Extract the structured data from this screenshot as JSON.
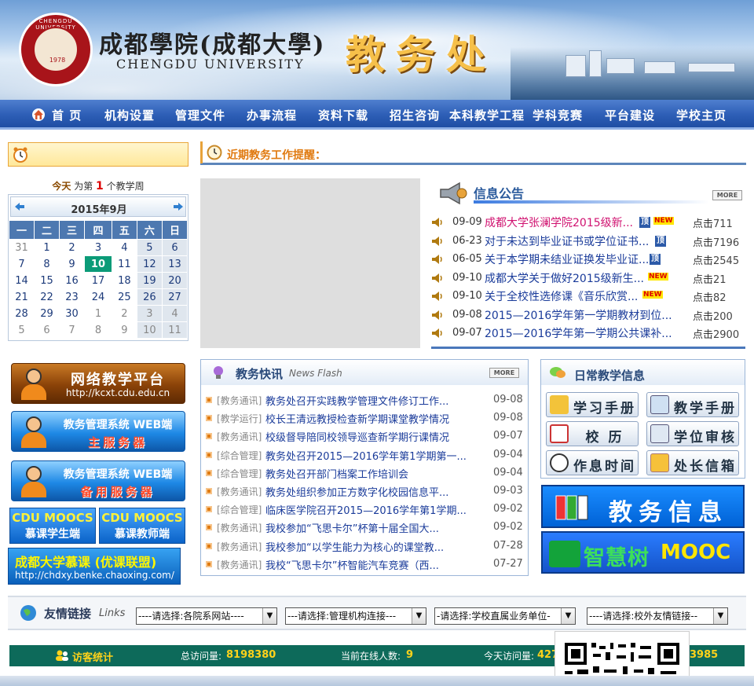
{
  "banner": {
    "school_cn": "成都學院(成都大學)",
    "school_en": "CHENGDU UNIVERSITY",
    "seal_ring": "CHENGDU UNIVERSITY",
    "seal_year": "1978",
    "office": "教务处"
  },
  "nav": {
    "items": [
      "首 页",
      "机构设置",
      "管理文件",
      "办事流程",
      "资料下载",
      "招生咨询",
      "本科教学工程",
      "学科竞赛",
      "平台建设",
      "学校主页"
    ]
  },
  "week": {
    "prefix": "今天",
    "mid": "为第",
    "num": "1",
    "suffix": "个教学周"
  },
  "calendar": {
    "title": "2015年9月",
    "weekdays": [
      "一",
      "二",
      "三",
      "四",
      "五",
      "六",
      "日"
    ],
    "rows": [
      [
        "31",
        "1",
        "2",
        "3",
        "4",
        "5",
        "6"
      ],
      [
        "7",
        "8",
        "9",
        "10",
        "11",
        "12",
        "13"
      ],
      [
        "14",
        "15",
        "16",
        "17",
        "18",
        "19",
        "20"
      ],
      [
        "21",
        "22",
        "23",
        "24",
        "25",
        "26",
        "27"
      ],
      [
        "28",
        "29",
        "30",
        "1",
        "2",
        "3",
        "4"
      ],
      [
        "5",
        "6",
        "7",
        "8",
        "9",
        "10",
        "11"
      ]
    ],
    "today": "10"
  },
  "side_buttons": {
    "platform_title": "网络教学平台",
    "platform_url": "http://kcxt.cdu.edu.cn",
    "web_main_title": "教务管理系统 WEB端",
    "web_main_sub": "主服务器",
    "web_backup_title": "教务管理系统 WEB端",
    "web_backup_sub": "备用服务器",
    "mooc_student_a": "CDU MOOCS",
    "mooc_student_b": "慕课学生端",
    "mooc_teacher_a": "CDU MOOCS",
    "mooc_teacher_b": "慕课教师端",
    "benke_title": "成都大学慕课 (优课联盟)",
    "benke_url": "http://chdxy.benke.chaoxing.com/"
  },
  "reminder": {
    "text": "近期教务工作提醒："
  },
  "notice": {
    "title": "信息公告",
    "more": "MORE",
    "items": [
      {
        "date": "09-09",
        "title": "成都大学张澜学院2015级新...",
        "hits": "711"
      },
      {
        "date": "06-23",
        "title": "对于未达到毕业证书或学位证书...",
        "hits": "7196"
      },
      {
        "date": "06-05",
        "title": "关于本学期未结业证换发毕业证...",
        "hits": "2545"
      },
      {
        "date": "09-10",
        "title": "成都大学关于做好2015级新生...",
        "hits": "21"
      },
      {
        "date": "09-10",
        "title": "关于全校性选修课《音乐欣赏...",
        "hits": "82"
      },
      {
        "date": "09-08",
        "title": "2015—2016学年第一学期教材到位...",
        "hits": "200"
      },
      {
        "date": "09-07",
        "title": "2015—2016学年第一学期公共课补...",
        "hits": "2900"
      }
    ],
    "hit_label": "点击",
    "ding": "顶",
    "new": "NEW"
  },
  "news": {
    "title": "教务快讯",
    "sub": "News Flash",
    "more": "MORE",
    "items": [
      {
        "cat": "[教务通讯]",
        "title": "教务处召开实践教学管理文件修订工作...",
        "date": "09-08"
      },
      {
        "cat": "[教学运行]",
        "title": "校长王清远教授检查新学期课堂教学情况",
        "date": "09-08"
      },
      {
        "cat": "[教务通讯]",
        "title": "校级督导陪同校领导巡查新学期行课情况",
        "date": "09-07"
      },
      {
        "cat": "[综合管理]",
        "title": "教务处召开2015—2016学年第1学期第一...",
        "date": "09-04"
      },
      {
        "cat": "[综合管理]",
        "title": "教务处召开部门档案工作培训会",
        "date": "09-04"
      },
      {
        "cat": "[教务通讯]",
        "title": "教务处组织参加正方数字化校园信息平...",
        "date": "09-03"
      },
      {
        "cat": "[综合管理]",
        "title": "临床医学院召开2015—2016学年第1学期...",
        "date": "09-02"
      },
      {
        "cat": "[教务通讯]",
        "title": "我校参加“飞思卡尔”杯第十届全国大...",
        "date": "09-02"
      },
      {
        "cat": "[教务通讯]",
        "title": "我校参加“以学生能力为核心的课堂教...",
        "date": "07-28"
      },
      {
        "cat": "[教务通讯]",
        "title": "我校“飞思卡尔”杯智能汽车竞赛（西...",
        "date": "07-27"
      }
    ]
  },
  "daily": {
    "title": "日常教学信息",
    "buttons": [
      "学习手册",
      "教学手册",
      "校  历",
      "学位审核",
      "作息时间",
      "处长信箱"
    ]
  },
  "jwinfo": {
    "text": "教务信息"
  },
  "zhs": {
    "t1": "智慧树",
    "t2": "MOOC"
  },
  "links": {
    "title": "友情链接",
    "sub": "Links",
    "selects": [
      "----请选择:各院系网站----",
      "---请选择:管理机构连接---",
      "-请选择:学校直属业务单位-",
      "----请选择:校外友情链接--"
    ]
  },
  "stats": {
    "label": "访客统计",
    "total_label": "总访问量:",
    "total": "8198380",
    "online_label": "当前在线人数:",
    "online": "9",
    "today_label": "今天访问量:",
    "today_a": "427",
    "today_b": "3985"
  },
  "colors": {
    "nav": "#2d5eb6",
    "accent_orange": "#e07a10",
    "link_blue": "#1a3b9a",
    "today_green": "#0b9b78",
    "stats_bg": "#0d6a5a"
  }
}
